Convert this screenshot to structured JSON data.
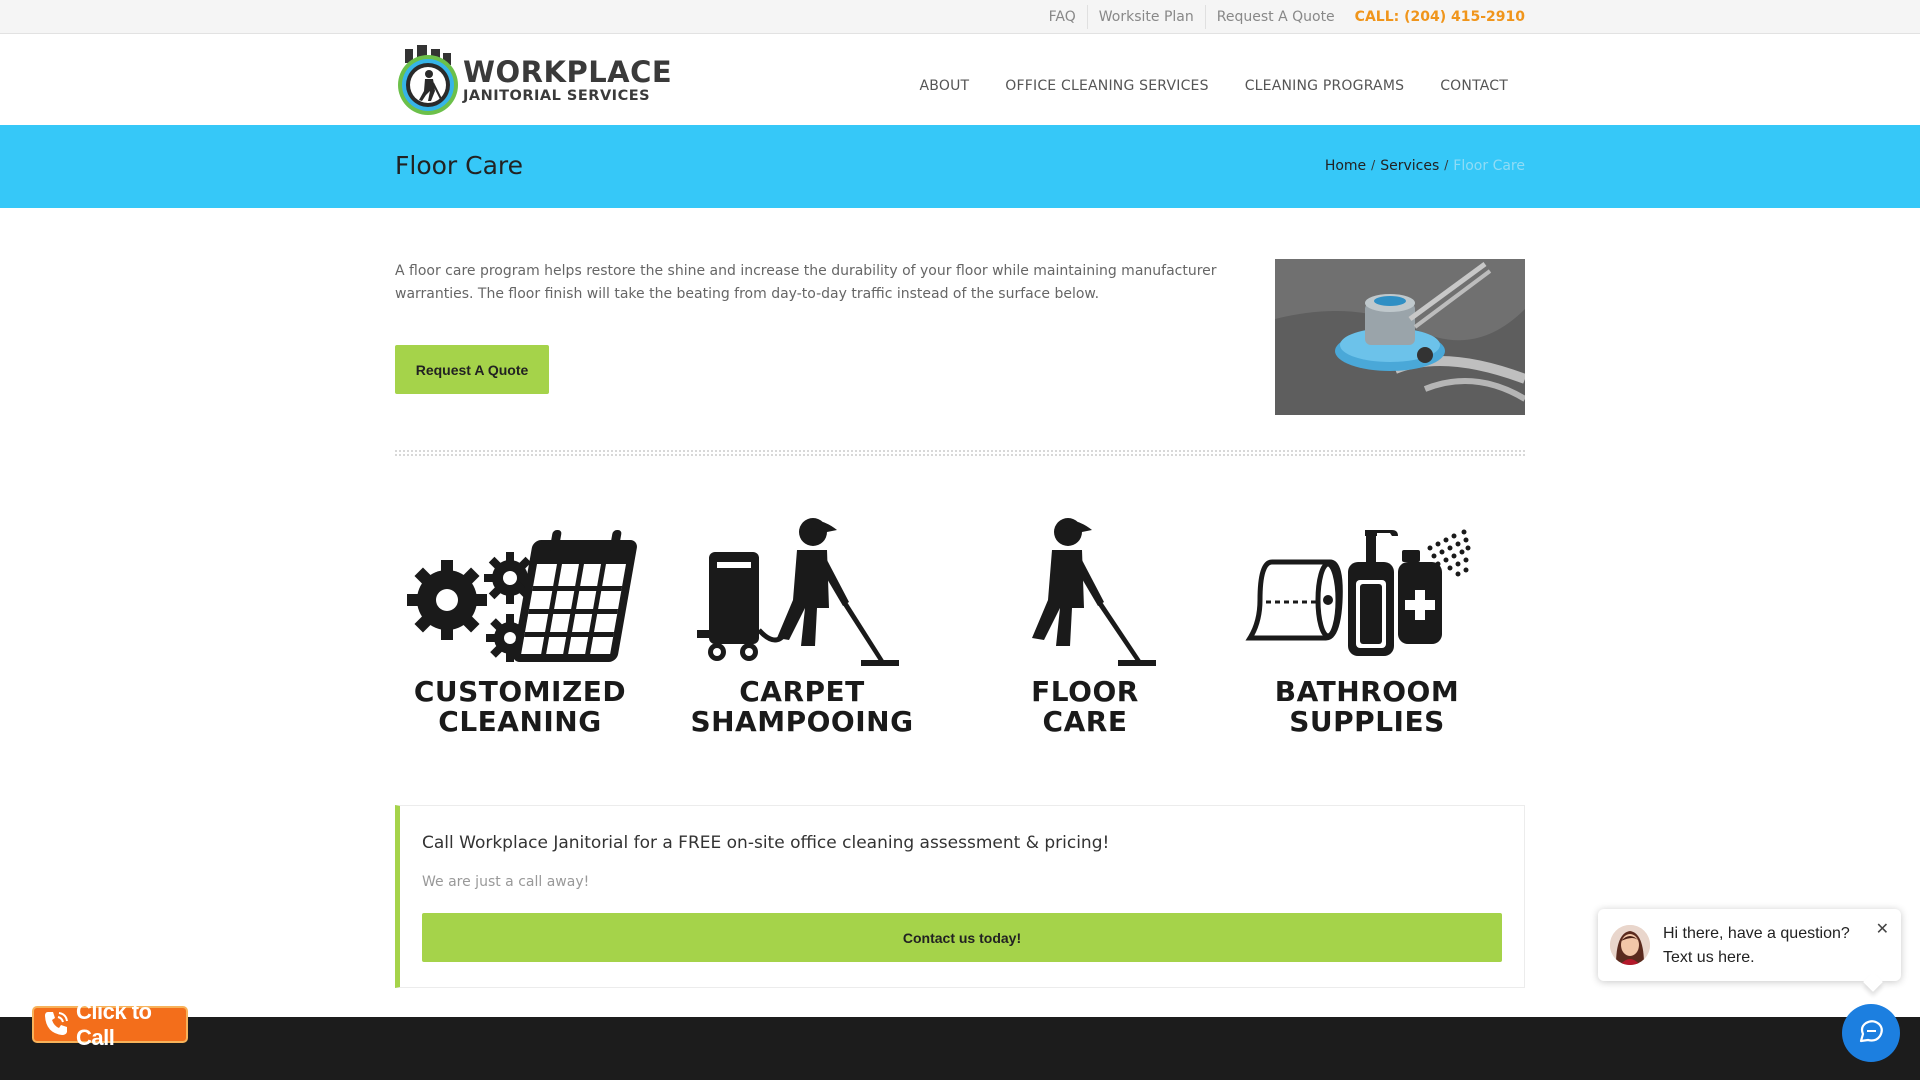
{
  "topbar": {
    "links": [
      "FAQ",
      "Worksite Plan",
      "Request A Quote"
    ],
    "call": "CALL: (204) 415-2910"
  },
  "logo": {
    "line1": "WORKPLACE",
    "line2": "JANITORIAL SERVICES"
  },
  "nav": {
    "items": [
      "ABOUT",
      "OFFICE CLEANING SERVICES",
      "CLEANING PROGRAMS",
      "CONTACT"
    ]
  },
  "title_bar": {
    "title": "Floor Care",
    "breadcrumb": [
      "Home",
      "Services",
      "Floor Care"
    ],
    "separator": "/"
  },
  "intro": {
    "text": "A floor care program helps restore the shine and increase the durability of your floor while maintaining manufacturer warranties. The floor finish will take the beating from day-to-day traffic instead of the surface below.",
    "button": "Request A Quote"
  },
  "services": [
    {
      "line1": "CUSTOMIZED",
      "line2": "CLEANING",
      "icon": "gears-calendar-icon"
    },
    {
      "line1": "CARPET",
      "line2": "SHAMPOOING",
      "icon": "carpet-shampoo-icon"
    },
    {
      "line1": "FLOOR",
      "line2": "CARE",
      "icon": "floor-mopping-icon"
    },
    {
      "line1": "BATHROOM",
      "line2": "SUPPLIES",
      "icon": "bathroom-supplies-icon"
    }
  ],
  "cta": {
    "title": "Call Workplace Janitorial for a FREE on-site office cleaning assessment & pricing!",
    "subtitle": "We are just a call away!",
    "button": "Contact us today!"
  },
  "click_to_call": {
    "label": "Click to Call"
  },
  "chat": {
    "line1": "Hi there, have a question?",
    "line2": "Text us here.",
    "close": "✕"
  },
  "colors": {
    "accent_blue": "#36c8f8",
    "accent_green": "#a5d34a",
    "call_orange": "#f0951b",
    "chat_blue": "#1c7fe0"
  }
}
